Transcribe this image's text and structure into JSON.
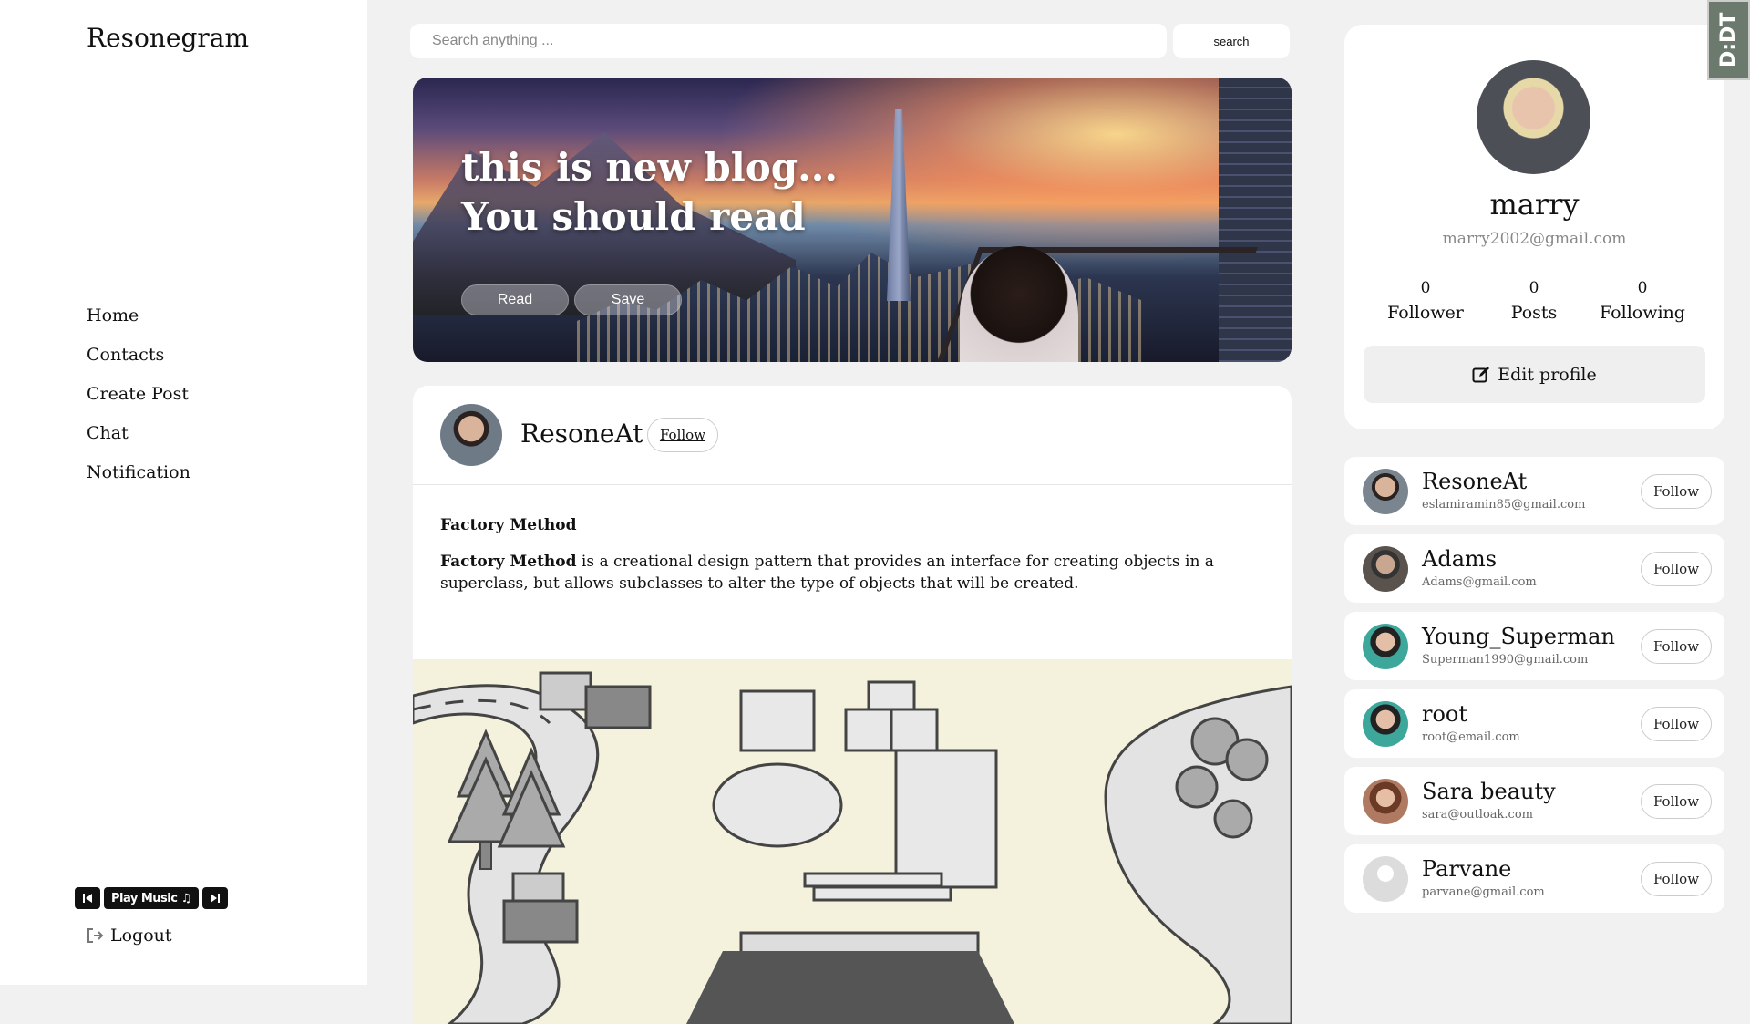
{
  "app": {
    "brand": "Resonegram"
  },
  "nav": {
    "items": [
      "Home",
      "Contacts",
      "Create Post",
      "Chat",
      "Notification"
    ]
  },
  "player": {
    "play_label": "Play Music ♫"
  },
  "logout_label": "Logout",
  "search": {
    "placeholder": "Search anything ...",
    "button": "search"
  },
  "banner": {
    "title": "this is new blog... You should read",
    "read_label": "Read",
    "save_label": "Save"
  },
  "post": {
    "author": "ResoneAt",
    "follow_label": "Follow",
    "heading": "Factory Method",
    "text_bold": "Factory Method",
    "text_rest": " is a creational design pattern that provides an interface for creating objects in a superclass, but allows subclasses to alter the type of objects that will be created."
  },
  "profile": {
    "name": "marry",
    "email": "marry2002@gmail.com",
    "stats": [
      {
        "value": "0",
        "label": "Follower"
      },
      {
        "value": "0",
        "label": "Posts"
      },
      {
        "value": "0",
        "label": "Following"
      }
    ],
    "edit_label": "Edit profile"
  },
  "suggested": [
    {
      "name": "ResoneAt",
      "email": "eslamiramin85@gmail.com",
      "follow": "Follow",
      "avatar_color": "#7a8590"
    },
    {
      "name": "Adams",
      "email": "Adams@gmail.com",
      "follow": "Follow",
      "avatar_color": "#5a524c"
    },
    {
      "name": "Young_Superman",
      "email": "Superman1990@gmail.com",
      "follow": "Follow",
      "avatar_color": "#3ca79a"
    },
    {
      "name": "root",
      "email": "root@email.com",
      "follow": "Follow",
      "avatar_color": "#3ca79a"
    },
    {
      "name": "Sara beauty",
      "email": "sara@outloak.com",
      "follow": "Follow",
      "avatar_color": "#b07a62"
    },
    {
      "name": "Parvane",
      "email": "parvane@gmail.com",
      "follow": "Follow",
      "avatar_color": "#dcdcdc"
    }
  ],
  "corner_badge": "D:DT"
}
